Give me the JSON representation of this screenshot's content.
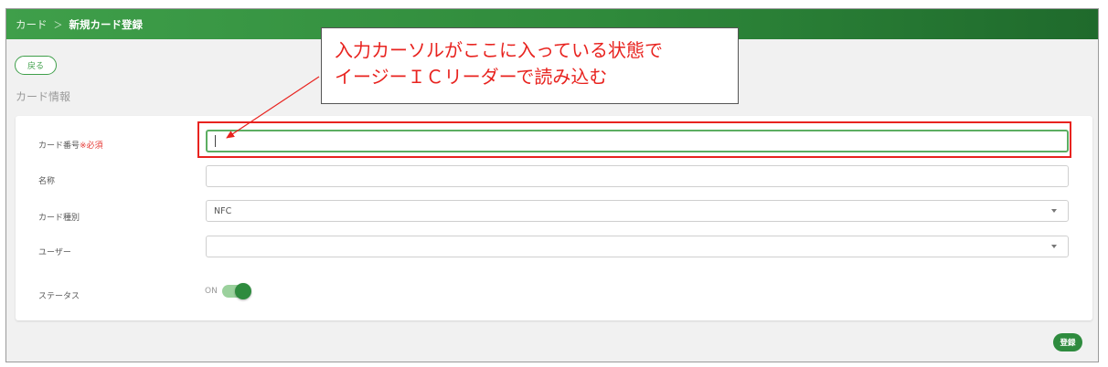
{
  "header": {
    "breadcrumb_parent": "カード",
    "breadcrumb_sep": "＞",
    "breadcrumb_current": "新規カード登録"
  },
  "back_button_label": "戻る",
  "section_title": "カード情報",
  "form": {
    "card_number": {
      "label": "カード番号",
      "required_text": "※必須",
      "value": ""
    },
    "name": {
      "label": "名称",
      "value": ""
    },
    "card_type": {
      "label": "カード種別",
      "value": "NFC"
    },
    "user": {
      "label": "ユーザー",
      "value": ""
    },
    "status": {
      "label": "ステータス",
      "toggle_text": "ON",
      "on": true
    }
  },
  "register_button_label": "登録",
  "annotation": {
    "line1": "入力カーソルがここに入っている状態で",
    "line2": "イージーＩＣリーダーで読み込む",
    "color": "#e8231f"
  },
  "colors": {
    "header_green": "#3f9f4a",
    "accent_green": "#2e8b3e",
    "required_red": "#e53935"
  }
}
